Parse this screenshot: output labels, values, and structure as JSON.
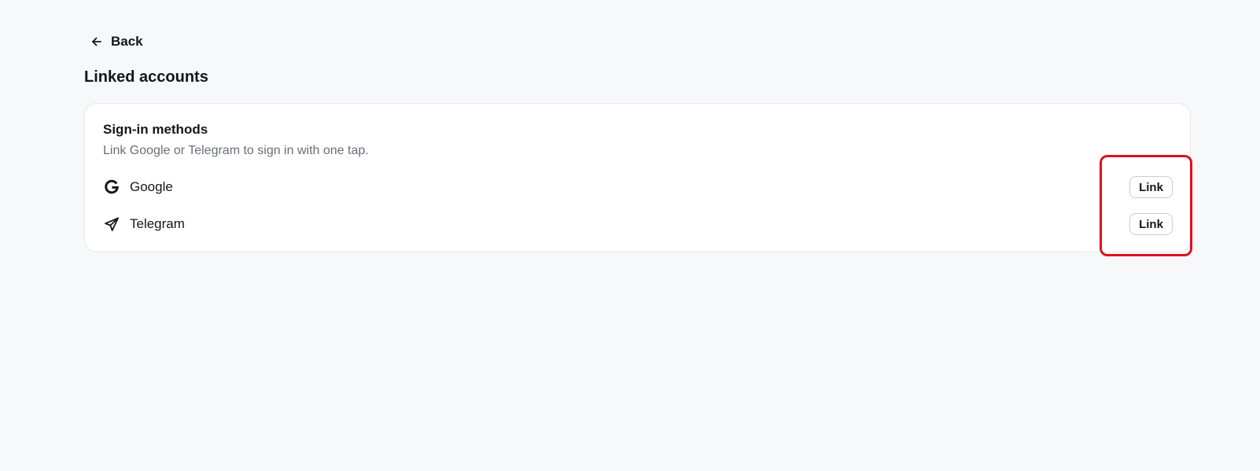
{
  "nav": {
    "back_label": "Back",
    "back_icon": "arrow-left-icon"
  },
  "page": {
    "title": "Linked accounts"
  },
  "sign_in_methods": {
    "title": "Sign-in methods",
    "subtitle": "Link Google or Telegram to sign in with one tap.",
    "methods": [
      {
        "name": "Google",
        "icon": "google-icon",
        "action_label": "Link"
      },
      {
        "name": "Telegram",
        "icon": "telegram-icon",
        "action_label": "Link"
      }
    ]
  },
  "colors": {
    "background": "#f7f8fa",
    "card": "#ffffff",
    "text_primary": "#15151d",
    "text_secondary": "#6a6e79",
    "highlight": "#e0101e"
  }
}
